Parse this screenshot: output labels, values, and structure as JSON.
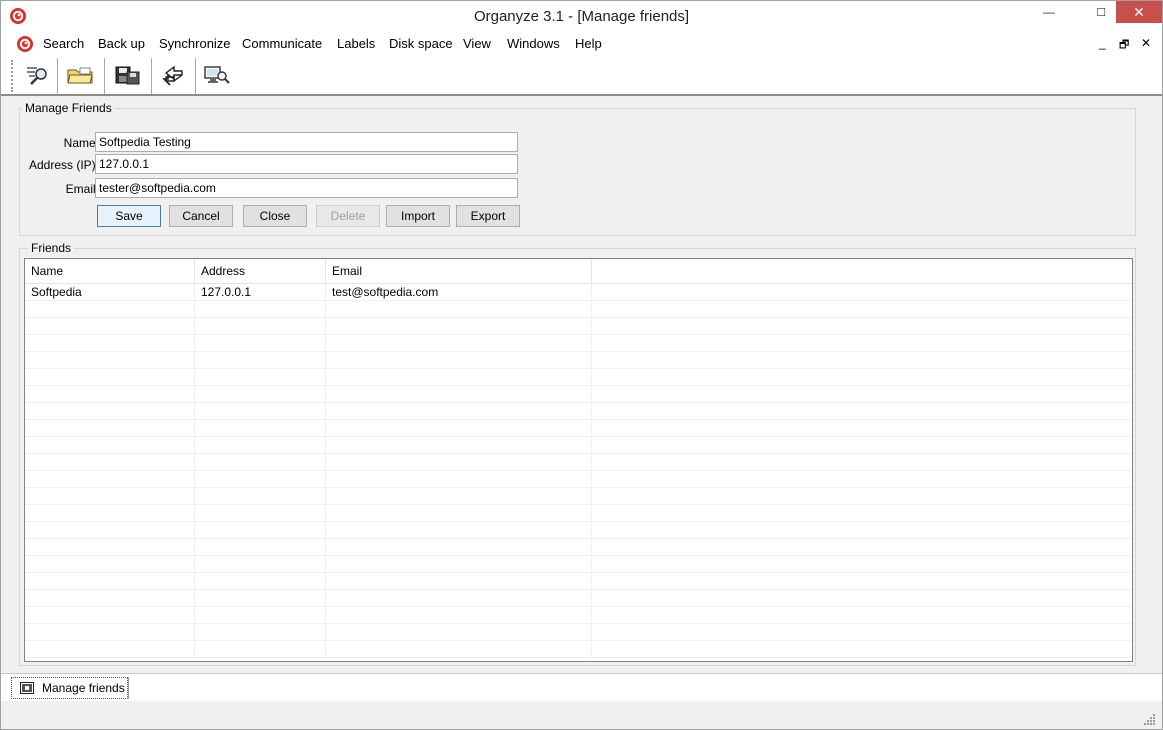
{
  "window": {
    "title": "Organyze 3.1 - [Manage friends]",
    "controls": {
      "minimize": "—",
      "maximize": "☐",
      "close": "✕"
    }
  },
  "menu": {
    "items": [
      "Search",
      "Back up",
      "Synchronize",
      "Communicate",
      "Labels",
      "Disk space",
      "View",
      "Windows",
      "Help"
    ],
    "mdi_controls": {
      "minimize": "_",
      "restore": "🗗",
      "close": "✕"
    }
  },
  "toolbar": {
    "buttons": [
      "search-files-icon",
      "open-folder-icon",
      "backup-disk-icon",
      "synchronize-arrows-icon",
      "network-computer-icon"
    ]
  },
  "manage_friends": {
    "legend": "Manage Friends",
    "fields": {
      "name": {
        "label": "Name:",
        "value": "Softpedia Testing"
      },
      "address": {
        "label": "Address (IP):",
        "value": "127.0.0.1"
      },
      "email": {
        "label": "Email:",
        "value": "tester@softpedia.com"
      }
    },
    "buttons": {
      "save": "Save",
      "cancel": "Cancel",
      "close": "Close",
      "delete": "Delete",
      "import": "Import",
      "export": "Export"
    }
  },
  "friends": {
    "legend": "Friends",
    "columns": [
      "Name",
      "Address",
      "Email"
    ],
    "rows": [
      {
        "name": "Softpedia",
        "address": "127.0.0.1",
        "email": "test@softpedia.com"
      }
    ]
  },
  "tabs": {
    "active": "Manage friends"
  },
  "colors": {
    "accent_red": "#d9322b",
    "close_button": "#c7504b",
    "default_button_border": "#3c7fb1"
  }
}
